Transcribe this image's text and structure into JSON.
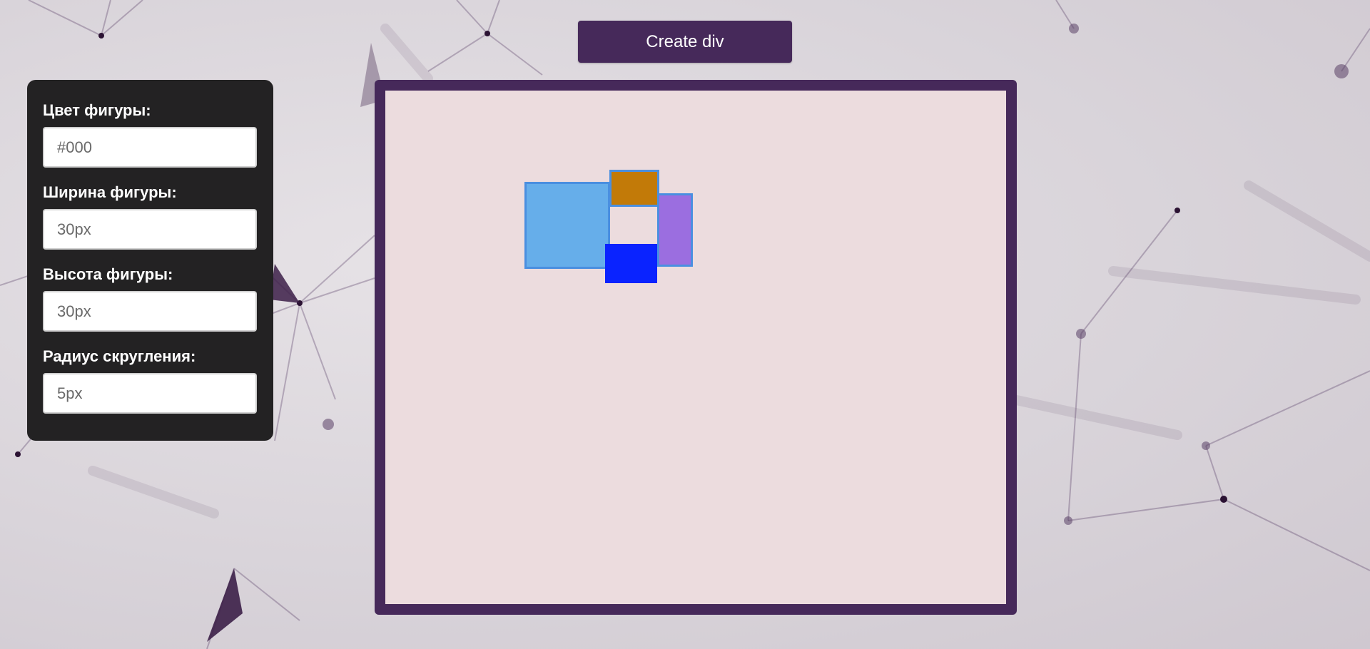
{
  "toolbar": {
    "create_label": "Create div"
  },
  "settings": {
    "fields": [
      {
        "label": "Цвет фигуры:",
        "placeholder": "#000",
        "value": ""
      },
      {
        "label": "Ширина фигуры:",
        "placeholder": "30px",
        "value": ""
      },
      {
        "label": "Высота фигуры:",
        "placeholder": "30px",
        "value": ""
      },
      {
        "label": "Радиус скругления:",
        "placeholder": "5px",
        "value": ""
      }
    ]
  },
  "shapes": [
    {
      "name": "light-blue",
      "color": "#66aeea",
      "border": "#4a8fe0"
    },
    {
      "name": "orange",
      "color": "#c27a08",
      "border": "#4a8fe0"
    },
    {
      "name": "violet",
      "color": "#9b6ee0",
      "border": "#4a8fe0"
    },
    {
      "name": "blue",
      "color": "#0a23ff",
      "border": ""
    }
  ],
  "colors": {
    "accent": "#46295a",
    "panel": "#232223",
    "canvas": "#ecdcde"
  }
}
